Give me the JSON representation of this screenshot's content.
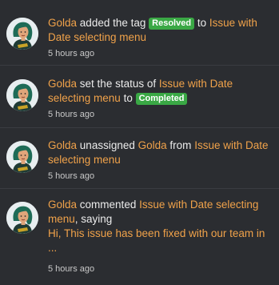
{
  "feed": {
    "items": [
      {
        "actor": "Golda",
        "verb": "added the tag",
        "tag": "Resolved",
        "connector": "to",
        "target": "Issue with Date selecting menu",
        "time": "5 hours ago"
      },
      {
        "actor": "Golda",
        "verb": "set the status of",
        "target": "Issue with Date selecting menu",
        "connector": "to",
        "status": "Completed",
        "time": "5 hours ago"
      },
      {
        "actor": "Golda",
        "verb": "unassigned",
        "assignee": "Golda",
        "connector": "from",
        "target": "Issue with Date selecting menu",
        "time": "5 hours ago"
      },
      {
        "actor": "Golda",
        "verb": "commented",
        "target": "Issue with Date selecting menu",
        "suffix": ", saying",
        "comment": "Hi, This issue has been fixed with our team in",
        "ellipsis": "...",
        "time": "5 hours ago"
      }
    ]
  },
  "colors": {
    "background": "#2b2d31",
    "link": "#f0a24a",
    "badge": "#3aa845",
    "text": "#ececec"
  },
  "icons": {
    "avatar": "user-avatar-icon"
  }
}
